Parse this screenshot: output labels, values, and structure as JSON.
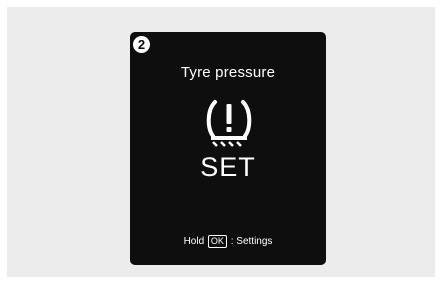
{
  "screen": {
    "step_number": "2",
    "title": "Tyre pressure",
    "status": "SET",
    "icon": "tpms-warning-icon",
    "hint": {
      "prefix": "Hold",
      "key": "OK",
      "suffix": ": Settings"
    }
  },
  "colors": {
    "screen_background": "#0e0e0e",
    "text": "#ffffff",
    "backdrop": "#ececec"
  }
}
